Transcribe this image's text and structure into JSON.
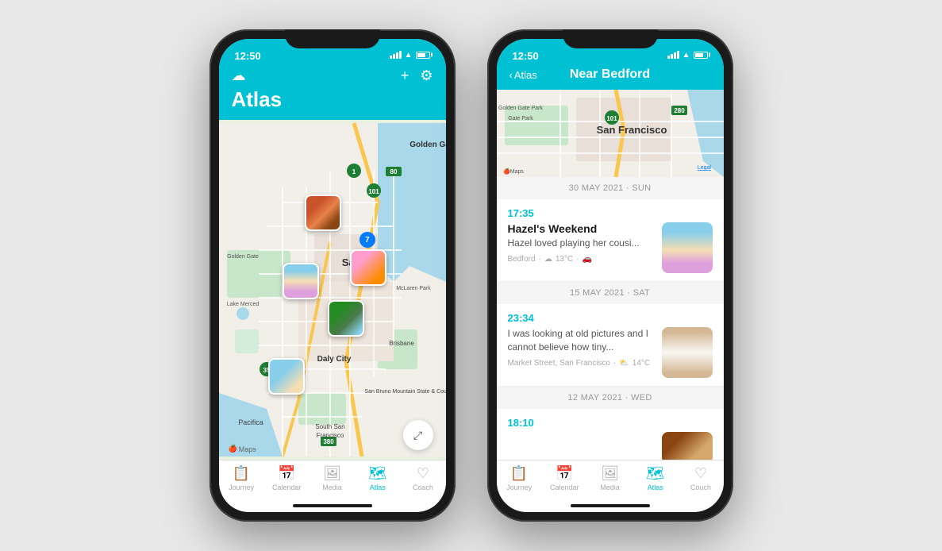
{
  "phones": [
    {
      "id": "left",
      "status_bar": {
        "time": "12:50",
        "signal": "●●●",
        "wifi": "WiFi",
        "battery": "Battery"
      },
      "header": {
        "cloud_icon": "☁",
        "add_icon": "+",
        "settings_icon": "⚙",
        "title": "Atlas"
      },
      "map": {
        "apple_maps_label": "Maps",
        "expand_tooltip": "Expand",
        "locations": [
          "Golden Gate",
          "San Francisco",
          "Daly City",
          "Pacifica",
          "South San Francisco"
        ]
      },
      "tab_bar": {
        "tabs": [
          {
            "icon": "🗒",
            "label": "Journey",
            "active": false
          },
          {
            "icon": "📅",
            "label": "Calendar",
            "active": false
          },
          {
            "icon": "🖼",
            "label": "Media",
            "active": false
          },
          {
            "icon": "🗺",
            "label": "Atlas",
            "active": true
          },
          {
            "icon": "♡",
            "label": "Coach",
            "active": false
          }
        ]
      }
    },
    {
      "id": "right",
      "status_bar": {
        "time": "12:50",
        "signal": "●●●",
        "wifi": "WiFi",
        "battery": "Battery"
      },
      "header": {
        "back_label": "Atlas",
        "title": "Near Bedford"
      },
      "entries": [
        {
          "date_separator": "30 MAY 2021 · SUN",
          "time": "17:35",
          "title": "Hazel's Weekend",
          "preview": "Hazel loved playing her cousi...",
          "location": "Bedford",
          "temp": "13°C",
          "thumb_type": "hazel"
        },
        {
          "date_separator": "15 MAY 2021 · SAT",
          "time": "23:34",
          "title": "",
          "preview": "I was looking at old pictures and I cannot believe how tiny...",
          "location": "Market Street, San Francisco",
          "temp": "14°C",
          "thumb_type": "dog"
        },
        {
          "date_separator": "12 MAY 2021 · WED",
          "time": "18:10",
          "title": "",
          "preview": "",
          "location": "",
          "temp": "",
          "thumb_type": "bottom"
        }
      ],
      "tab_bar": {
        "tabs": [
          {
            "icon": "🗒",
            "label": "Journey",
            "active": false
          },
          {
            "icon": "📅",
            "label": "Calendar",
            "active": false
          },
          {
            "icon": "🖼",
            "label": "Media",
            "active": false
          },
          {
            "icon": "🗺",
            "label": "Atlas",
            "active": true
          },
          {
            "icon": "♡",
            "label": "Couch",
            "active": false
          }
        ]
      }
    }
  ]
}
